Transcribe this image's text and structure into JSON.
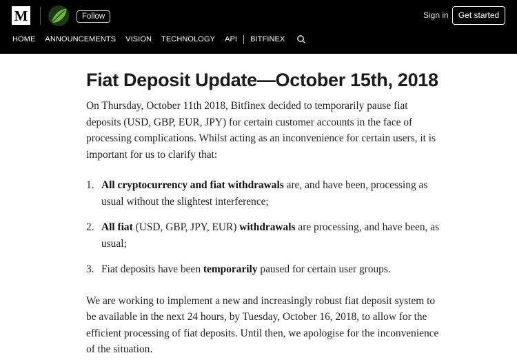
{
  "header": {
    "logo_text": "M",
    "follow_label": "Follow",
    "signin_label": "Sign in",
    "getstarted_label": "Get started",
    "nav": [
      "HOME",
      "ANNOUNCEMENTS",
      "VISION",
      "TECHNOLOGY",
      "API",
      "BITFINEX"
    ],
    "bg_color": "#000000",
    "leaf_color": "#6fb33f"
  },
  "article": {
    "title": "Fiat Deposit Update—October 15th, 2018",
    "intro": "On Thursday, October 11th 2018, Bitfinex decided to temporarily pause fiat deposits (USD, GBP, EUR, JPY) for certain customer accounts in the face of processing complications. Whilst acting as an inconvenience for certain users, it is important for us to clarify that:",
    "list": [
      {
        "num": "1.",
        "bold1": "All cryptocurrency and fiat withdrawals",
        "text1": " are, and have been, processing as usual without the slightest interference;"
      },
      {
        "num": "2.",
        "bold1": "All fiat",
        "text1": " (USD, GBP, JPY, EUR) ",
        "bold2": "withdrawals",
        "text2": " are processing, and have been, as usual;"
      },
      {
        "num": "3.",
        "text0": "Fiat deposits have been ",
        "bold1": "temporarily",
        "text1": " paused for certain user groups."
      }
    ],
    "closing": "We are working to implement a new and increasingly robust fiat deposit system to be available in the next 24 hours, by Tuesday, October 16, 2018, to allow for the efficient processing of fiat deposits. Until then, we apologise for the inconvenience of the situation."
  }
}
